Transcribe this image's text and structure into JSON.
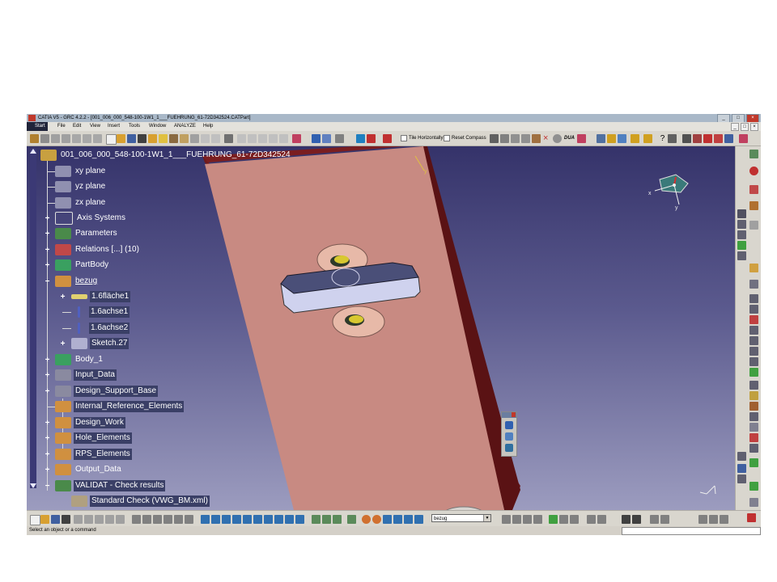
{
  "window": {
    "title": "CATIA V5 - GRC 4.2.2 - [001_006_000_548-100-1W1_1___FUEHRUNG_61-72D342524.CATPart]",
    "controls": [
      "_",
      "□",
      "×"
    ]
  },
  "menubar": {
    "items": [
      "Start",
      "File",
      "Edit",
      "View",
      "Insert",
      "Tools",
      "Window",
      "ANALYZE",
      "Help"
    ],
    "mdi_controls": [
      "_",
      "□",
      "×"
    ]
  },
  "toolbar": {
    "tile_horizontally": "Tile Horizontally",
    "reset_compass": "Reset Compass",
    "dua_label": "DUA"
  },
  "tree": {
    "root": "001_006_000_548-100-1W1_1___FUEHRUNG_61-72D342524",
    "nodes": [
      {
        "label": "xy plane"
      },
      {
        "label": "yz plane"
      },
      {
        "label": "zx plane"
      },
      {
        "label": "Axis Systems"
      },
      {
        "label": "Parameters"
      },
      {
        "label": "Relations [...] (10)"
      },
      {
        "label": "PartBody"
      },
      {
        "label": "bezug"
      },
      {
        "label": "1.6fläche1"
      },
      {
        "label": "1.6achse1"
      },
      {
        "label": "1.6achse2"
      },
      {
        "label": "Sketch.27"
      },
      {
        "label": "Body_1"
      },
      {
        "label": "Input_Data"
      },
      {
        "label": "Design_Support_Base"
      },
      {
        "label": "Internal_Reference_Elements"
      },
      {
        "label": "Design_Work"
      },
      {
        "label": "Hole_Elements"
      },
      {
        "label": "RPS_Elements"
      },
      {
        "label": "Output_Data"
      },
      {
        "label": "VALIDAT - Check results"
      },
      {
        "label": "Standard Check (VWG_BM.xml)"
      }
    ]
  },
  "compass": {
    "x_label": "x",
    "y_label": "y"
  },
  "model_axes": {
    "y_label": "y"
  },
  "layer": {
    "value": "bezug"
  },
  "status": {
    "message": "Select an object or a command"
  },
  "colors": {
    "viewport_top": "#35336a",
    "viewport_bottom": "#9c9cbf",
    "plate_face": "#c88a82",
    "plate_edge": "#6e1a1c",
    "block_face": "#4a4f78",
    "block_side": "#cfd2ee",
    "washer": "#e7b9a8",
    "hole_inner": "#d8c830",
    "tree_selection": "#3a3f66"
  }
}
